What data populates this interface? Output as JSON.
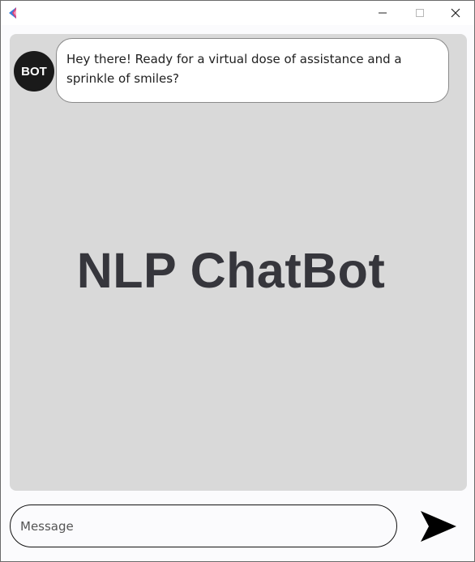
{
  "window": {
    "controls": {
      "minimize_icon": "minimize-icon",
      "maximize_icon": "maximize-icon",
      "close_icon": "close-icon"
    }
  },
  "chat": {
    "background_color": "#d9d9d9",
    "watermark": "NLP ChatBot",
    "messages": [
      {
        "sender": "BOT",
        "text": "Hey there! Ready for a virtual dose of assistance and a sprinkle of smiles?"
      }
    ]
  },
  "composer": {
    "placeholder": "Message",
    "value": "",
    "send_icon": "send-icon"
  }
}
